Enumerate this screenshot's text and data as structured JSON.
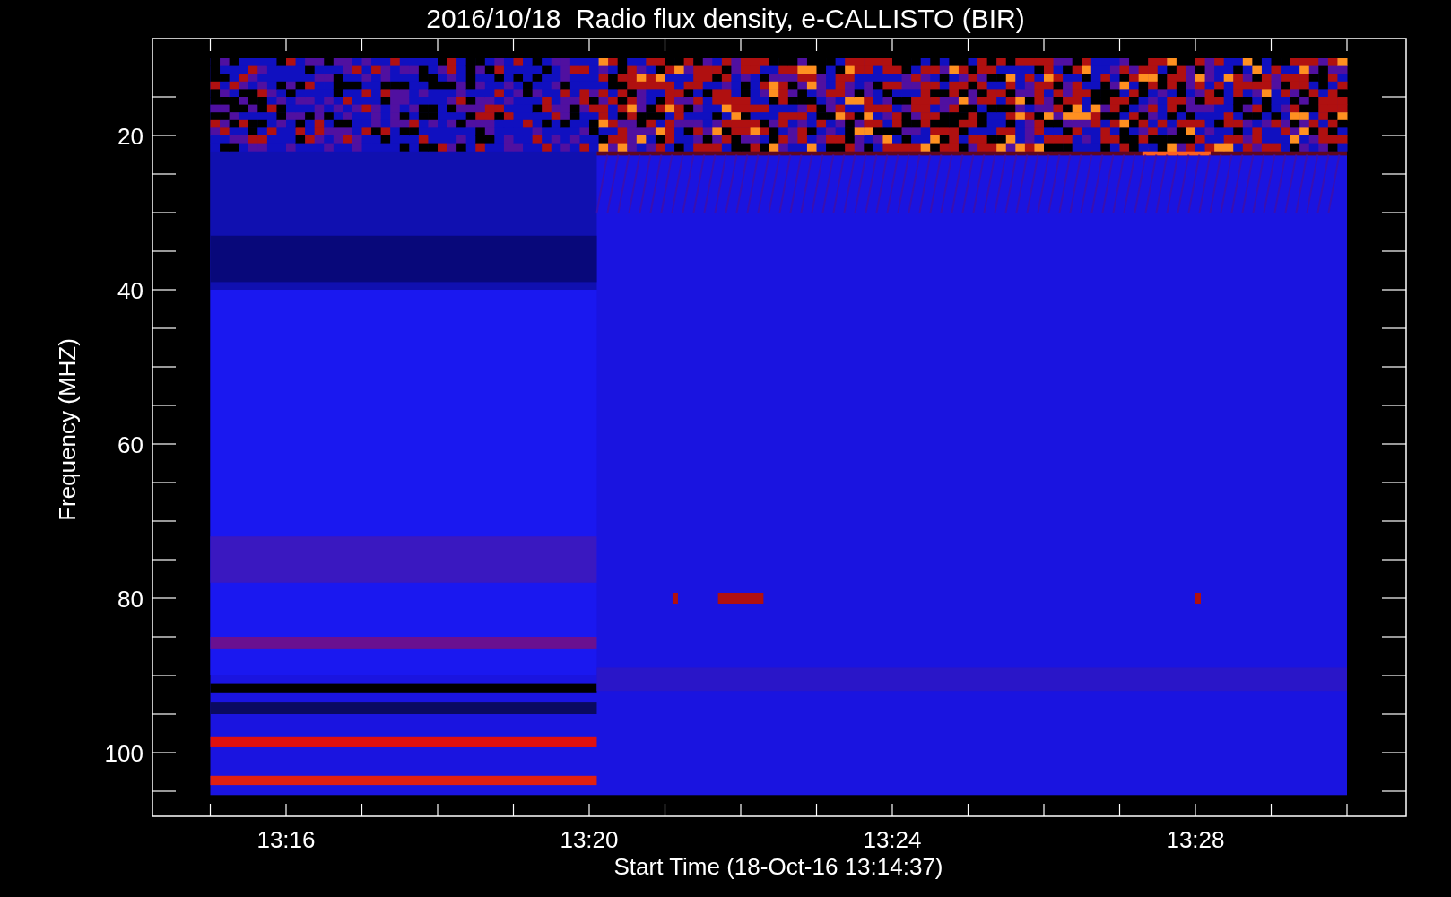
{
  "title": "2016/10/18  Radio flux density, e-CALLISTO (BIR)",
  "y_axis": {
    "label": "Frequency (MHZ)",
    "tick_labels": [
      "20",
      "40",
      "60",
      "80",
      "100"
    ]
  },
  "x_axis": {
    "label": "Start Time (18-Oct-16 13:14:37)",
    "tick_labels": [
      "13:16",
      "13:20",
      "13:24",
      "13:28"
    ]
  }
}
